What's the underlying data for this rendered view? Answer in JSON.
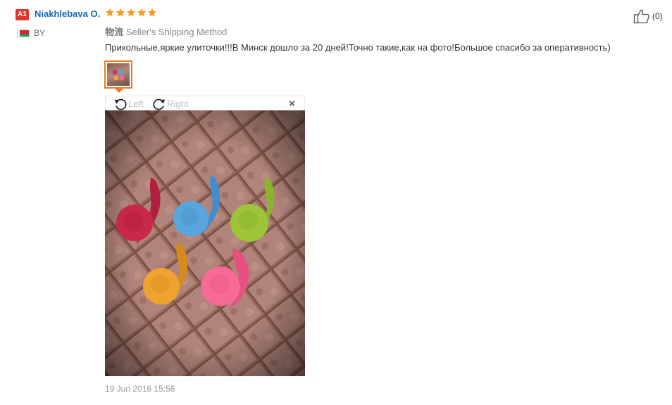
{
  "reviewer": {
    "level_badge": "A1",
    "name": "Niakhlebava O.",
    "rating": 5,
    "country_code": "BY",
    "flag_icon": "belarus-flag-icon"
  },
  "shipping": {
    "label": "物流",
    "method": "Seller's Shipping Method"
  },
  "review": {
    "text": "Прикольные,яркие улиточки!!!В Минск дошло за 20 дней!Точно такие,как на фото!Большое спасибо за оперативность)",
    "date": "19 Jun 2016 15:56"
  },
  "helpful": {
    "icon": "thumbs-up-icon",
    "count_text": "(0)"
  },
  "viewer": {
    "rotate_left_label": "Left",
    "rotate_right_label": "Right",
    "close_symbol": "×"
  },
  "colors": {
    "accent": "#f0781e",
    "name_link": "#1669b6",
    "star": "#f59a23",
    "badge": "#e0362c"
  }
}
